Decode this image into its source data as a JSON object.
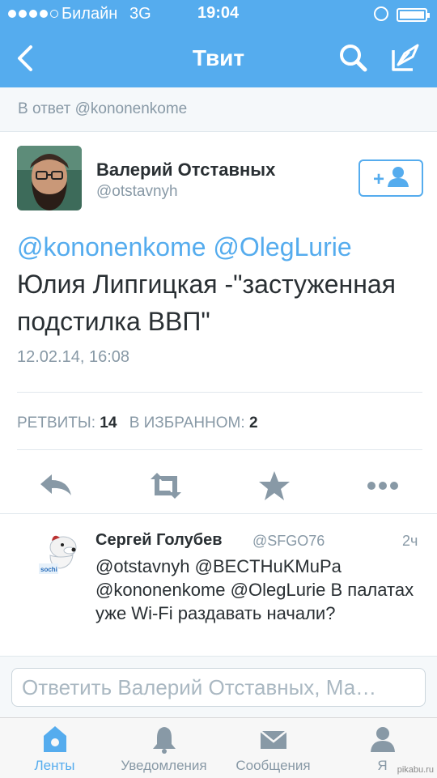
{
  "status_bar": {
    "carrier": "Билайн",
    "network": "3G",
    "time": "19:04"
  },
  "nav": {
    "title": "Твит",
    "back_icon": "back-arrow-icon",
    "search_icon": "search-icon",
    "compose_icon": "compose-icon"
  },
  "reply_context": "В ответ @kononenkome",
  "tweet": {
    "author_name": "Валерий Отставных",
    "author_handle": "@otstavnyh",
    "follow_label": "+",
    "text_mention1": "@kononenkome",
    "text_mention2": "@OlegLurie",
    "text_body": "Юлия Липгицкая -\"застуженная подстилка ВВП\"",
    "date": "12.02.14, 16:08",
    "retweets_label": "РЕТВИТЫ:",
    "retweets_count": "14",
    "favorites_label": "В ИЗБРАННОМ:",
    "favorites_count": "2"
  },
  "reply": {
    "author_name": "Сергей Голубев",
    "author_handle": "@SFGO76",
    "time": "2ч",
    "text": "@otstavnyh @BECTHuKMuPa @kononenkome @OlegLurie В палатах уже Wi-Fi раздавать начали?"
  },
  "compose": {
    "placeholder": "Ответить Валерий Отставных, Ма…"
  },
  "tabs": [
    {
      "label": "Ленты",
      "icon": "home-icon",
      "active": true
    },
    {
      "label": "Уведомления",
      "icon": "bell-icon",
      "active": false
    },
    {
      "label": "Сообщения",
      "icon": "envelope-icon",
      "active": false
    },
    {
      "label": "Я",
      "icon": "profile-icon",
      "active": false
    }
  ],
  "watermark": "pikabu.ru",
  "colors": {
    "accent": "#55acee",
    "text": "#292f33",
    "muted": "#8899a6"
  }
}
